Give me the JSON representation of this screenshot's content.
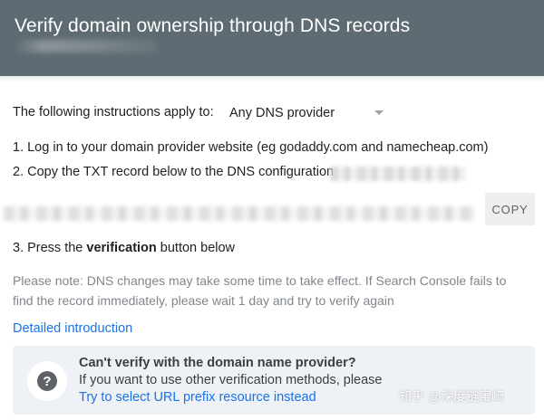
{
  "header": {
    "title": "Verify domain ownership through DNS records"
  },
  "instructions": {
    "apply_label": "The following instructions apply to:",
    "provider_selected": "Any DNS provider",
    "step1": "1. Log in to your domain provider website (eg godaddy.com and namecheap.com)",
    "step2": "2. Copy the TXT record below to the DNS configuration",
    "step3_prefix": "3. Press the ",
    "step3_bold": "verification",
    "step3_suffix": " button below"
  },
  "record": {
    "copy_label": "COPY"
  },
  "note": "Please note: DNS changes may take some time to take effect. If Search Console fails to find the record immediately, please wait 1 day and try to verify again",
  "detail_link": "Detailed introduction",
  "card": {
    "title": "Can't verify with the domain name provider?",
    "text": "If you want to use other verification methods, please",
    "link": "Try to select URL prefix resource instead",
    "icon": "help-icon",
    "icon_glyph": "?"
  },
  "watermark": "知乎 @深度链寓崎",
  "colors": {
    "header_bg": "#5f6b73",
    "link": "#1a73e8",
    "card_bg": "#eef1f6",
    "note_text": "#80868b"
  }
}
